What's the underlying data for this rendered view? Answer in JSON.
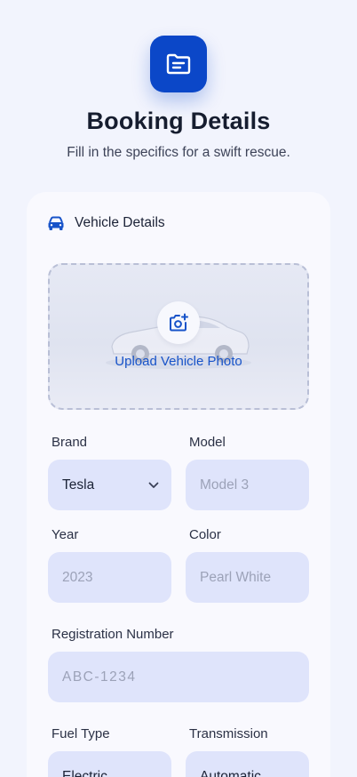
{
  "header": {
    "icon": "document-icon",
    "title": "Booking Details",
    "subtitle": "Fill in the specifics for a swift rescue."
  },
  "colors": {
    "accent": "#0b47c8",
    "field_bg": "#dfe4fb",
    "placeholder": "#9ca2b8",
    "background": "#f2f4fd",
    "card": "#f9f9fe"
  },
  "vehicle_section": {
    "icon": "car-icon",
    "label": "Vehicle Details",
    "upload": {
      "icon": "add-photo-icon",
      "label": "Upload Vehicle Photo"
    },
    "brand": {
      "label": "Brand",
      "value": "Tesla"
    },
    "model": {
      "label": "Model",
      "placeholder": "Model 3"
    },
    "year": {
      "label": "Year",
      "placeholder": "2023"
    },
    "color": {
      "label": "Color",
      "placeholder": "Pearl White"
    },
    "registration": {
      "label": "Registration Number",
      "placeholder": "ABC-1234"
    },
    "fuel_type": {
      "label": "Fuel Type",
      "value": "Electric"
    },
    "transmission": {
      "label": "Transmission",
      "value": "Automatic"
    }
  }
}
